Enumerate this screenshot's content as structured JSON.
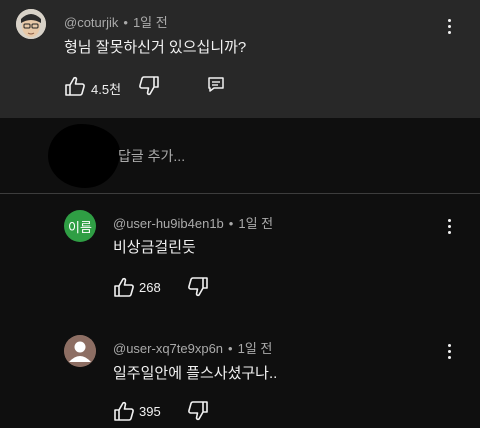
{
  "main_comment": {
    "author": "@coturjik",
    "time": "1일 전",
    "text": "형님 잘못하신거 있으십니까?",
    "likes": "4.5천",
    "icons": [
      "thumb-up-icon",
      "thumb-down-icon",
      "reply-icon",
      "more-vert-icon"
    ]
  },
  "reply_input": {
    "placeholder": "답글 추가..."
  },
  "replies": [
    {
      "author": "@user-hu9ib4en1b",
      "time": "1일 전",
      "text": "비상금걸린듯",
      "likes": "268",
      "avatar_label": "이름",
      "avatar_color": "#2f9e44"
    },
    {
      "author": "@user-xq7te9xp6n",
      "time": "1일 전",
      "text": "일주일안에 플스사셨구나..",
      "likes": "395",
      "avatar_color": "#8d6e63"
    }
  ],
  "separator": "•"
}
